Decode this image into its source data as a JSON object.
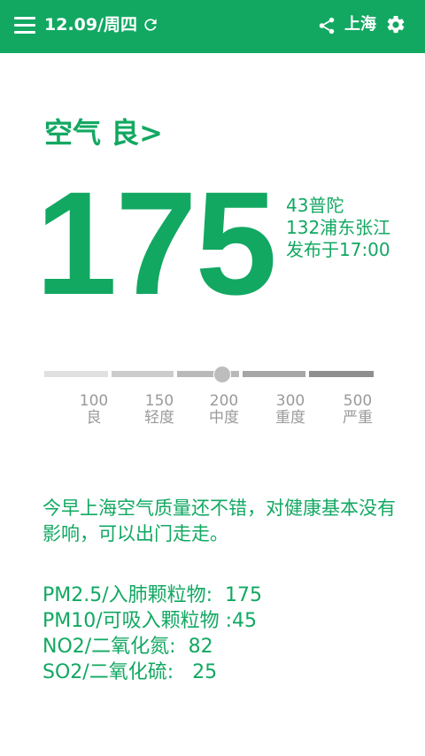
{
  "header": {
    "date": "12.09/周四",
    "city": "上海",
    "icons": {
      "menu": "menu-icon",
      "refresh": "refresh-icon",
      "share": "share-icon",
      "settings": "gear-icon"
    },
    "color": "#12a862"
  },
  "aqi": {
    "title": "空气 良>",
    "value": "175",
    "stations": [
      "43普陀",
      "132浦东张江",
      "发布于17:00"
    ],
    "level_position_percent": 54
  },
  "scale": {
    "ticks": [
      {
        "value": "100",
        "label": "良"
      },
      {
        "value": "150",
        "label": "轻度"
      },
      {
        "value": "200",
        "label": "中度"
      },
      {
        "value": "300",
        "label": "重度"
      },
      {
        "value": "500",
        "label": "严重"
      }
    ],
    "segment_colors": [
      "#e0e0e0",
      "#cccccc",
      "#b9b9b9",
      "#a6a6a6",
      "#8f8f8f"
    ]
  },
  "summary": "今早上海空气质量还不错，对健康基本没有影响，可以出门走走。",
  "pollutants": [
    "PM2.5/入肺颗粒物:  175",
    "PM10/可吸入颗粒物 :45",
    "NO2/二氧化氮:  82",
    "SO2/二氧化硫:   25"
  ]
}
